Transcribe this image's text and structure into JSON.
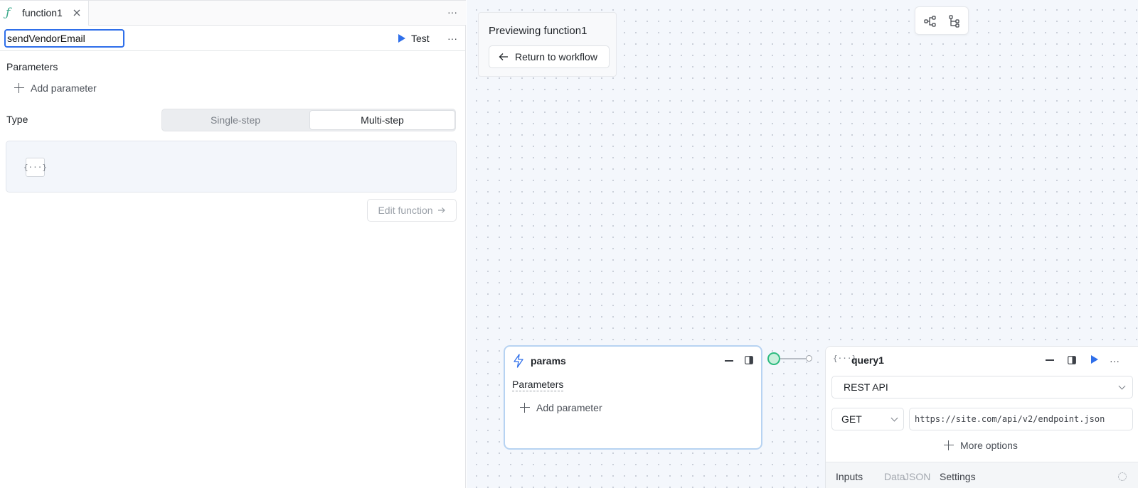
{
  "tab": {
    "label": "function1"
  },
  "editor": {
    "name_value": "sendVendorEmail",
    "test_label": "Test",
    "parameters_title": "Parameters",
    "add_parameter_label": "Add parameter",
    "type_label": "Type",
    "type_options": [
      "Single-step",
      "Multi-step"
    ],
    "type_selected": "Multi-step",
    "code_icon_glyph": "{···}",
    "edit_function_label": "Edit function"
  },
  "canvas": {
    "preview_title": "Previewing function1",
    "return_label": "Return to workflow",
    "params_node": {
      "title": "params",
      "parameters_label": "Parameters",
      "add_parameter_label": "Add parameter"
    },
    "query_node": {
      "title": "query1",
      "resource": "REST API",
      "method": "GET",
      "url_value": "https://site.com/api/v2/endpoint.json",
      "more_options_label": "More options",
      "footer_tabs": [
        "Inputs",
        "Data",
        "JSON",
        "Settings"
      ]
    }
  },
  "colors": {
    "accent": "#2f6fea",
    "success": "#2dbb7f",
    "function_icon": "#3aa88a"
  },
  "icons": {
    "tab": "function-icon",
    "close": "close-icon",
    "more": "more-horizontal-icon",
    "run": "play-icon",
    "plus": "plus-icon",
    "code": "code-braces-icon",
    "arrow_right": "arrow-right-icon",
    "arrow_left": "arrow-left-icon",
    "layout_graph": "graph-layout-icon",
    "layout_tree": "tree-layout-icon",
    "trigger": "lightning-bolt-icon",
    "minimize": "minimize-icon",
    "panel": "side-panel-icon",
    "chevron": "chevron-down-icon",
    "loading": "loading-spinner-icon"
  }
}
